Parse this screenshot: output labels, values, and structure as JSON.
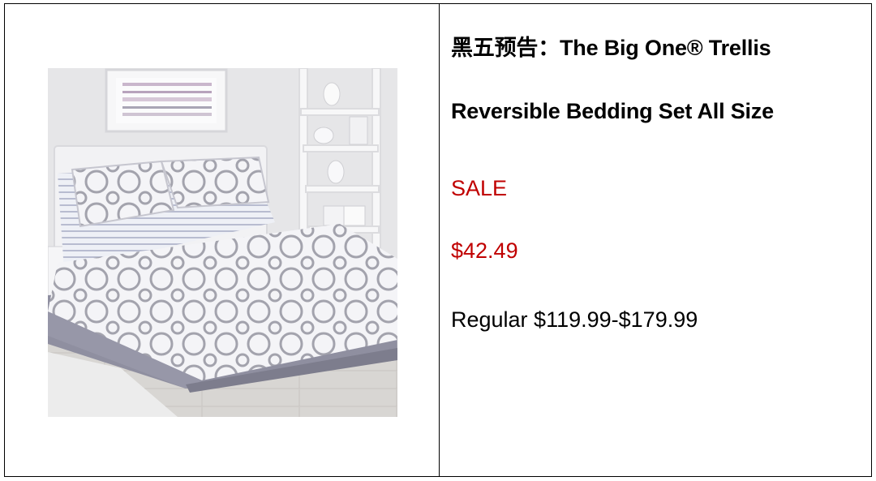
{
  "product": {
    "title_line1": "黑五预告：The Big One® Trellis",
    "title_line2": "Reversible Bedding Set All Size",
    "sale_label": "SALE",
    "sale_price": "$42.49",
    "regular_price": "Regular $119.99-$179.99",
    "image_subject": "bedding-set-photo"
  },
  "colors": {
    "sale": "#c00000",
    "border": "#000000"
  }
}
